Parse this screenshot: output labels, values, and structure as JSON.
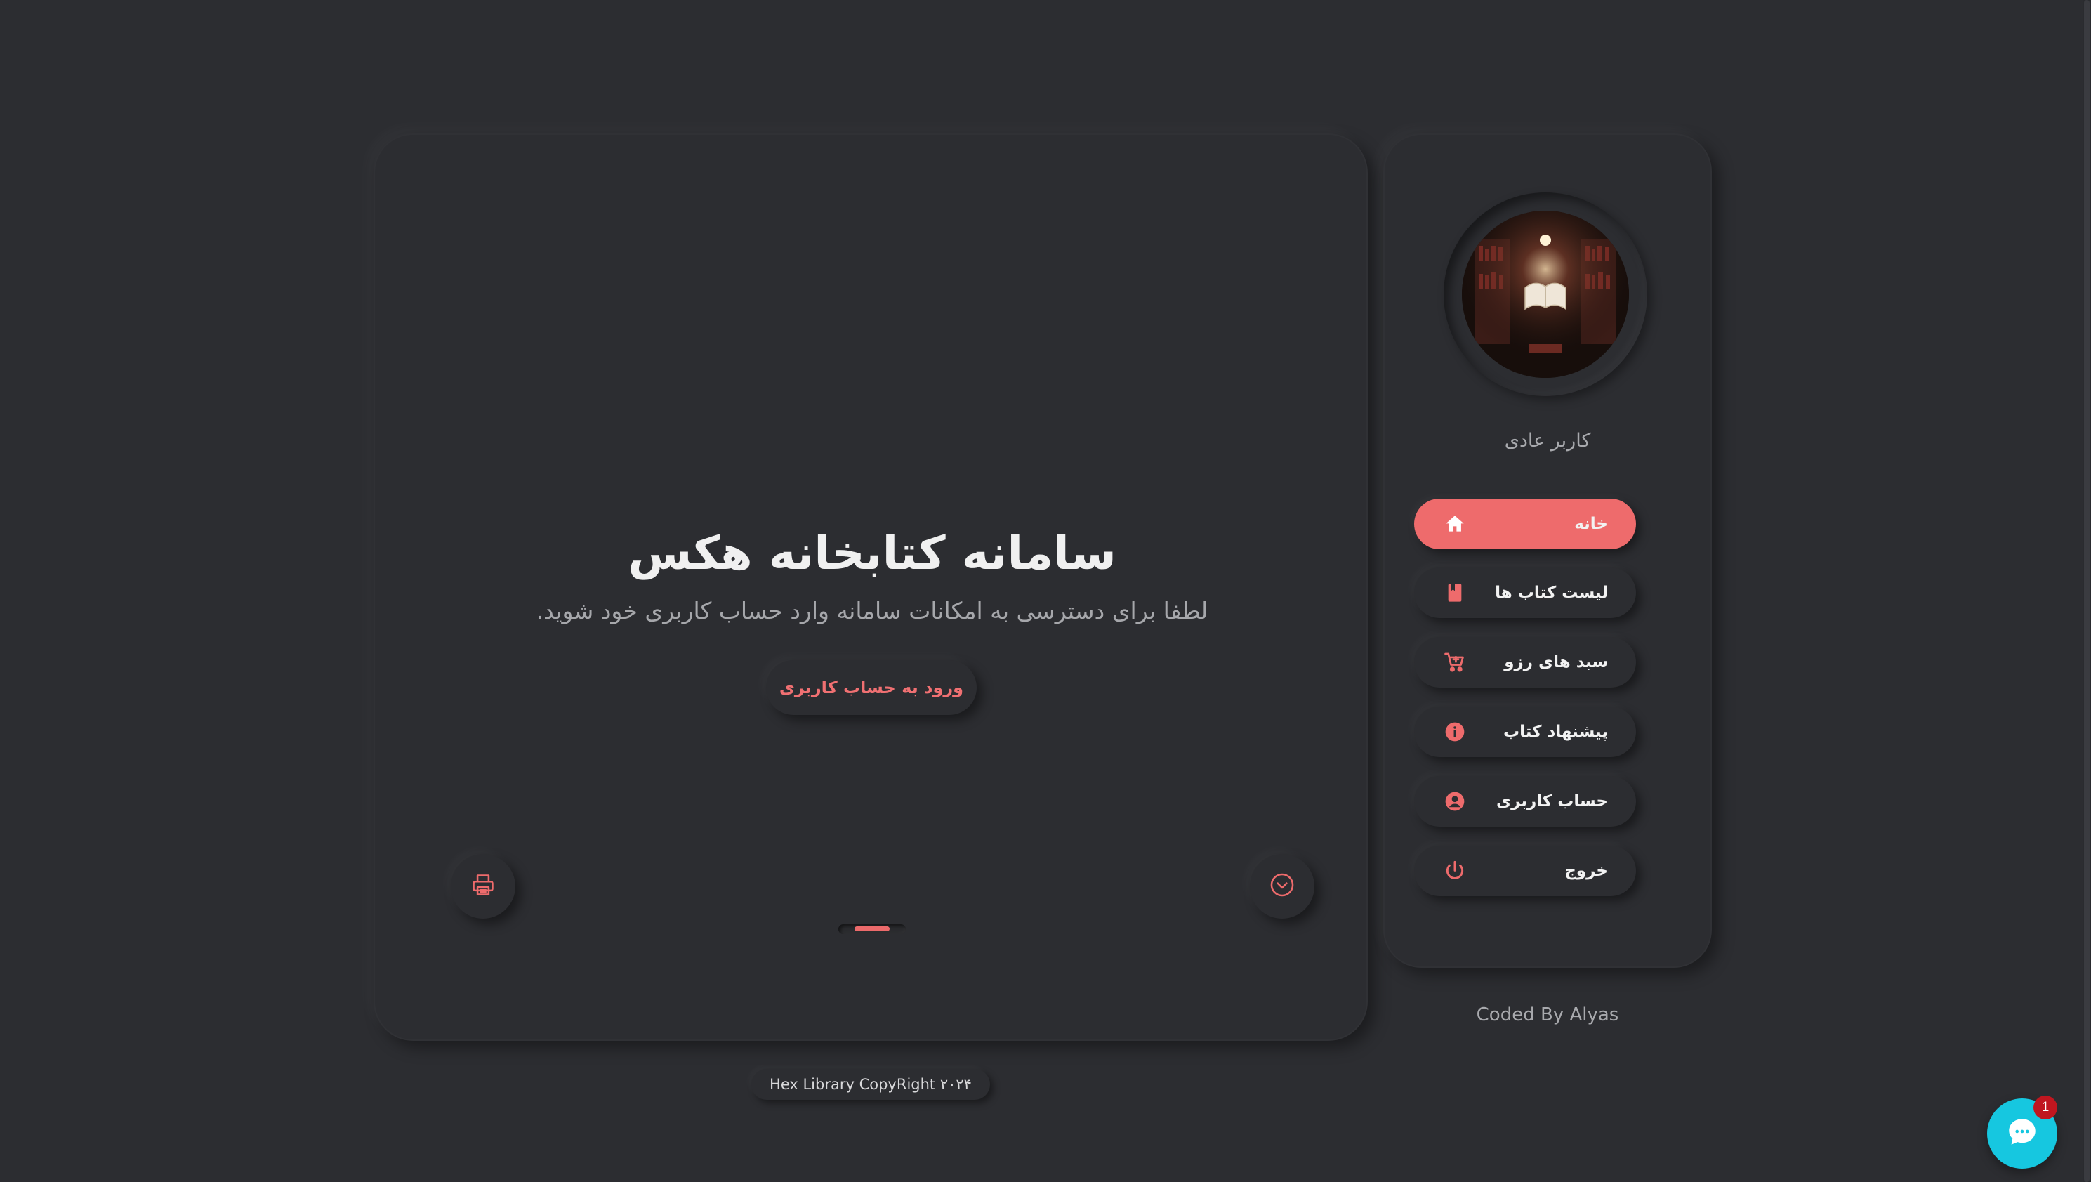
{
  "hero": {
    "title_main": "سامانه کتابخانه",
    "title_accent": "هکس",
    "subtitle": "لطفا برای دسترسی به امکانات سامانه وارد حساب کاربری خود شوید.",
    "login_label": "ورود به حساب کاربری"
  },
  "slider": {
    "position_fraction": 0.5
  },
  "sidebar": {
    "user_role": "کاربر عادی",
    "items": [
      {
        "label": "خانه",
        "icon": "home-icon",
        "active": true
      },
      {
        "label": "لیست کتاب ها",
        "icon": "book-icon",
        "active": false
      },
      {
        "label": "سبد های رزو",
        "icon": "cart-icon",
        "active": false
      },
      {
        "label": "پیشنهاد کتاب",
        "icon": "info-icon",
        "active": false
      },
      {
        "label": "حساب کاربری",
        "icon": "account-icon",
        "active": false
      },
      {
        "label": "خروج",
        "icon": "power-icon",
        "active": false
      }
    ]
  },
  "footer": {
    "coded_by": "Coded By Alyas",
    "copyright": "Hex Library CopyRight ۲۰۲۴"
  },
  "chat": {
    "badge_count": "1",
    "icon": "chat-bubble-icon"
  },
  "colors": {
    "background": "#2c2d31",
    "accent": "#ee6b6c",
    "chat": "#16c7e0",
    "badge": "#c0161f"
  }
}
